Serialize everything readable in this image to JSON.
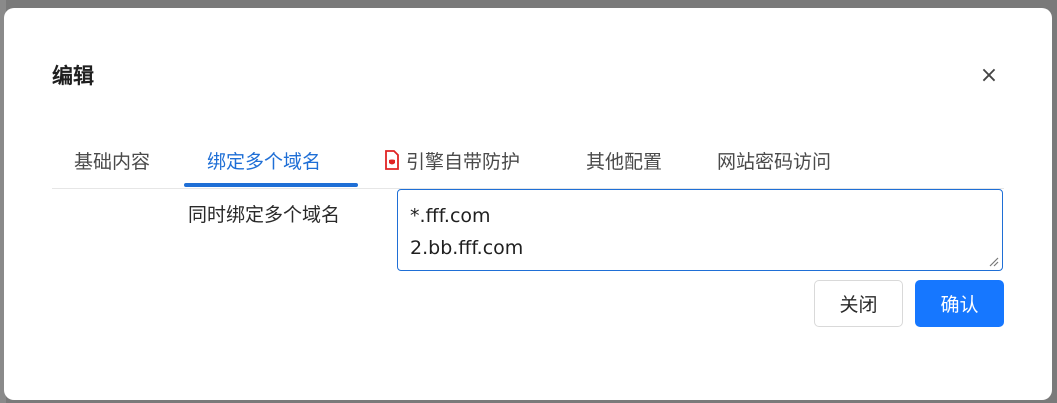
{
  "dialog": {
    "title": "编辑",
    "close_glyph": "×"
  },
  "tabs": [
    {
      "label": "基础内容",
      "active": false
    },
    {
      "label": "绑定多个域名",
      "active": true
    },
    {
      "label": "引擎自带防护",
      "active": false,
      "icon": "shield-icon"
    },
    {
      "label": "其他配置",
      "active": false
    },
    {
      "label": "网站密码访问",
      "active": false
    }
  ],
  "form": {
    "domains_label": "同时绑定多个域名",
    "domains_value": "*.fff.com\n2.bb.fff.com"
  },
  "buttons": {
    "close_label": "关闭",
    "confirm_label": "确认"
  },
  "colors": {
    "accent": "#1f6fd6",
    "primary_button": "#1677ff",
    "shield_icon": "#e02424"
  }
}
